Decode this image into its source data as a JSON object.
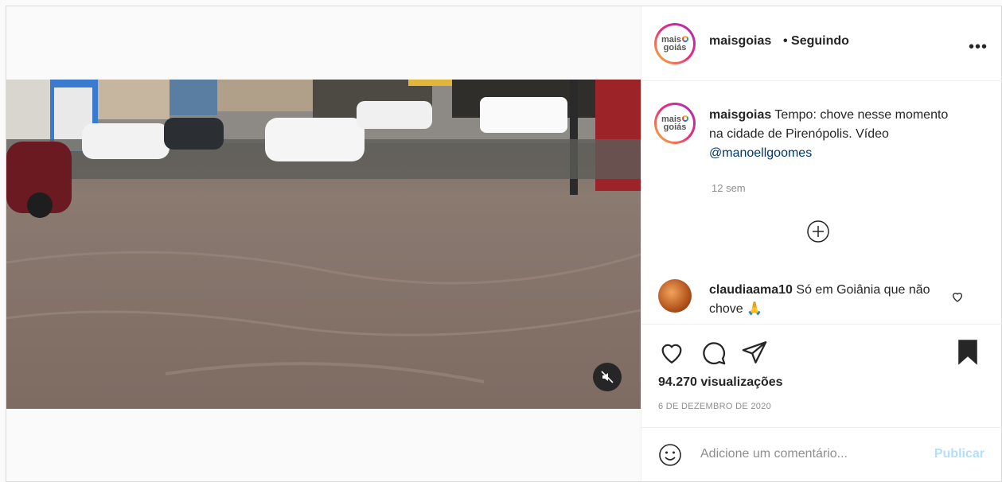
{
  "post": {
    "username": "maisgoias",
    "follow_status": "• Seguindo",
    "more_label": "•••",
    "logo_text": "mais",
    "logo_text_2": "goiás",
    "caption_user": "maisgoias",
    "caption_text": " Tempo: chove nesse momento na cidade de Pirenópolis. Vídeo ",
    "caption_mention": "@manoellgoomes",
    "timestamp": "12 sem",
    "comment": {
      "user": "claudiaama10",
      "text": " Só em Goiânia que não chove 🙏"
    },
    "views": "94.270 visualizações",
    "date": "6 DE DEZEMBRO DE 2020",
    "add_comment_placeholder": "Adicione um comentário...",
    "publish_label": "Publicar"
  },
  "icons": [
    "mute-icon",
    "more-icon",
    "plus-circle-icon",
    "heart-icon",
    "comment-icon",
    "share-icon",
    "bookmark-icon",
    "emoji-icon"
  ]
}
